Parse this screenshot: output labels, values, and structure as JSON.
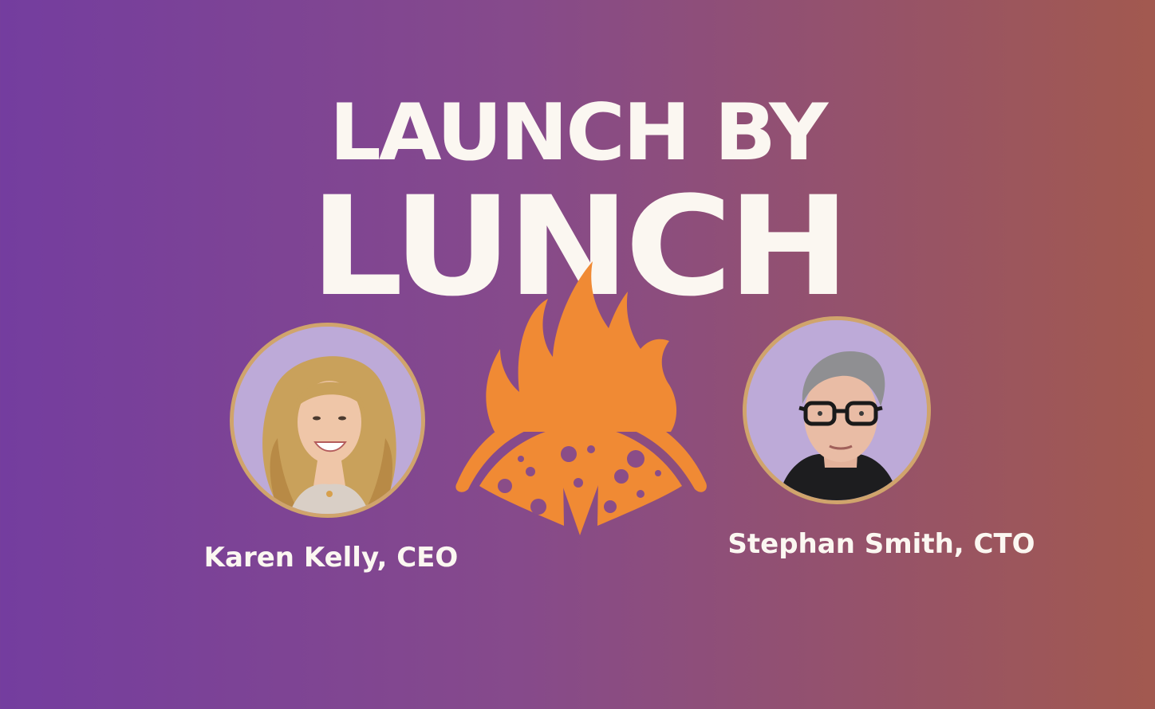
{
  "banner": {
    "title_line_1": "LAUNCH BY",
    "title_line_2": "LUNCH",
    "logo_icon": "flaming-pizza-icon"
  },
  "speakers": [
    {
      "name": "Karen Kelly, CEO",
      "photo": "karen-kelly-photo"
    },
    {
      "name": "Stephan Smith, CTO",
      "photo": "stephan-smith-photo"
    }
  ],
  "colors": {
    "background_left": "#743d9f",
    "background_right": "#a2594f",
    "title_text": "#fbf7f1",
    "logo_orange": "#f08a34",
    "avatar_ring": "#d0a46c",
    "avatar_fill": "#bdaad8"
  }
}
